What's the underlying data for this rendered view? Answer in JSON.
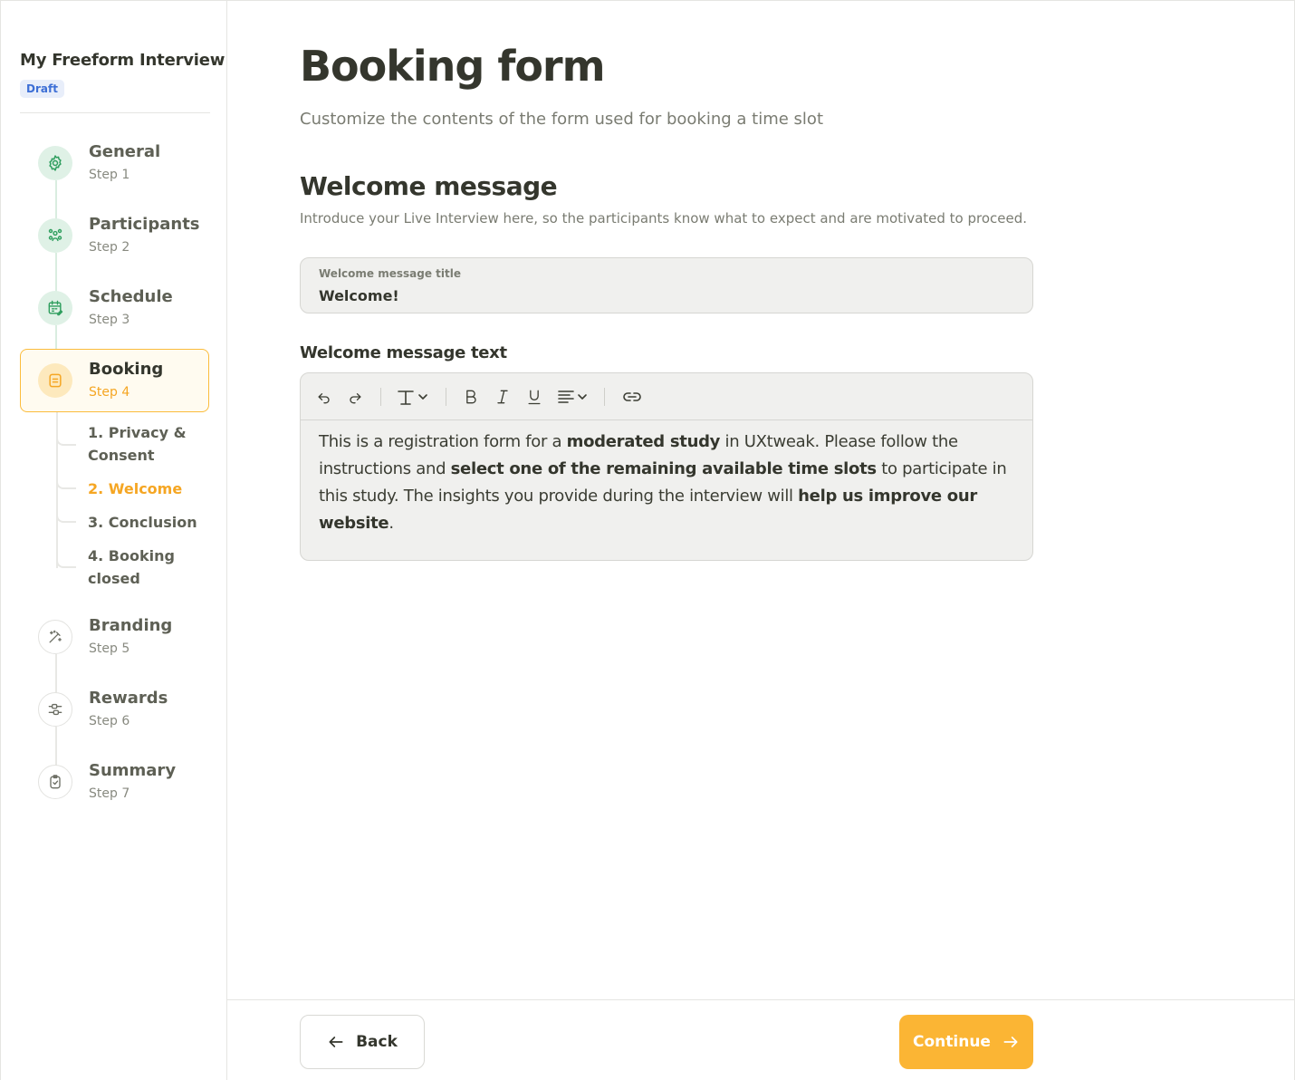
{
  "sidebar": {
    "study_title": "My Freeform Interview",
    "status_badge": "Draft",
    "steps": [
      {
        "name": "General",
        "sub": "Step 1",
        "icon": "gear-icon",
        "state": "done"
      },
      {
        "name": "Participants",
        "sub": "Step 2",
        "icon": "participants-icon",
        "state": "done"
      },
      {
        "name": "Schedule",
        "sub": "Step 3",
        "icon": "calendar-icon",
        "state": "done"
      },
      {
        "name": "Booking",
        "sub": "Step 4",
        "icon": "booking-form-icon",
        "state": "current"
      },
      {
        "name": "Branding",
        "sub": "Step 5",
        "icon": "magic-wand-icon",
        "state": "todo"
      },
      {
        "name": "Rewards",
        "sub": "Step 6",
        "icon": "sliders-icon",
        "state": "todo"
      },
      {
        "name": "Summary",
        "sub": "Step 7",
        "icon": "clipboard-check-icon",
        "state": "todo"
      }
    ],
    "substeps": [
      {
        "label": "1. Privacy & Consent",
        "active": false
      },
      {
        "label": "2. Welcome",
        "active": true
      },
      {
        "label": "3. Conclusion",
        "active": false
      },
      {
        "label": "4. Booking closed",
        "active": false
      }
    ]
  },
  "main": {
    "title": "Booking form",
    "subtitle": "Customize the contents of the form used for booking a time slot",
    "section": {
      "title": "Welcome message",
      "description": "Introduce your Live Interview here, so the participants know what to expect and are motivated to proceed."
    },
    "title_field": {
      "label": "Welcome message title",
      "value": "Welcome!"
    },
    "text_field": {
      "label": "Welcome message text",
      "segments": [
        {
          "text": "This is a registration form for a ",
          "bold": false
        },
        {
          "text": "moderated study",
          "bold": true
        },
        {
          "text": " in UXtweak. Please follow the instructions and ",
          "bold": false
        },
        {
          "text": "select one of the remaining available time slots",
          "bold": true
        },
        {
          "text": " to participate in this study. The insights you provide during the interview will ",
          "bold": false
        },
        {
          "text": "help us improve our website",
          "bold": true
        },
        {
          "text": ".",
          "bold": false
        }
      ]
    },
    "toolbar": [
      "undo-icon",
      "redo-icon",
      "text-style-icon",
      "bold-icon",
      "italic-icon",
      "underline-icon",
      "align-icon",
      "link-icon"
    ]
  },
  "footer": {
    "back_label": "Back",
    "continue_label": "Continue"
  },
  "colors": {
    "accent": "#fbb534",
    "accent_text": "#f5a623",
    "done_circle": "#dff1e6",
    "done_icon": "#2f9e5e",
    "badge_bg": "#e8eefa",
    "badge_text": "#3d6fd6"
  }
}
